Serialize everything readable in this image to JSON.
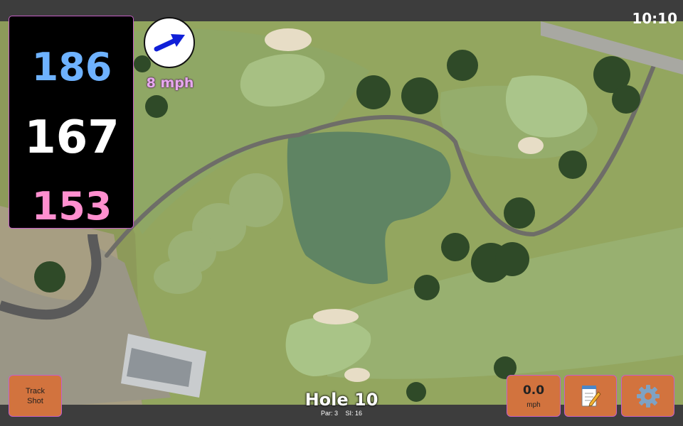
{
  "status": {
    "time": "10:10"
  },
  "distances": {
    "back": "186",
    "middle": "167",
    "front": "153"
  },
  "wind": {
    "speed": "8 mph",
    "direction_icon": "wind-arrow-icon"
  },
  "track_shot": {
    "label_line1": "Track",
    "label_line2": "Shot"
  },
  "hole": {
    "title": "Hole 10",
    "par": "Par: 3",
    "si": "SI: 16"
  },
  "shot_speed": {
    "value": "0.0",
    "unit": "mph"
  },
  "actions": {
    "notes_icon": "notepad-icon",
    "settings_icon": "gear-icon"
  },
  "colors": {
    "back_distance": "#6eb2ff",
    "middle_distance": "#ffffff",
    "front_distance": "#ff8fcf",
    "button": "#d2733e",
    "wind_text": "#e7a8ee",
    "arrow": "#1020d8"
  }
}
